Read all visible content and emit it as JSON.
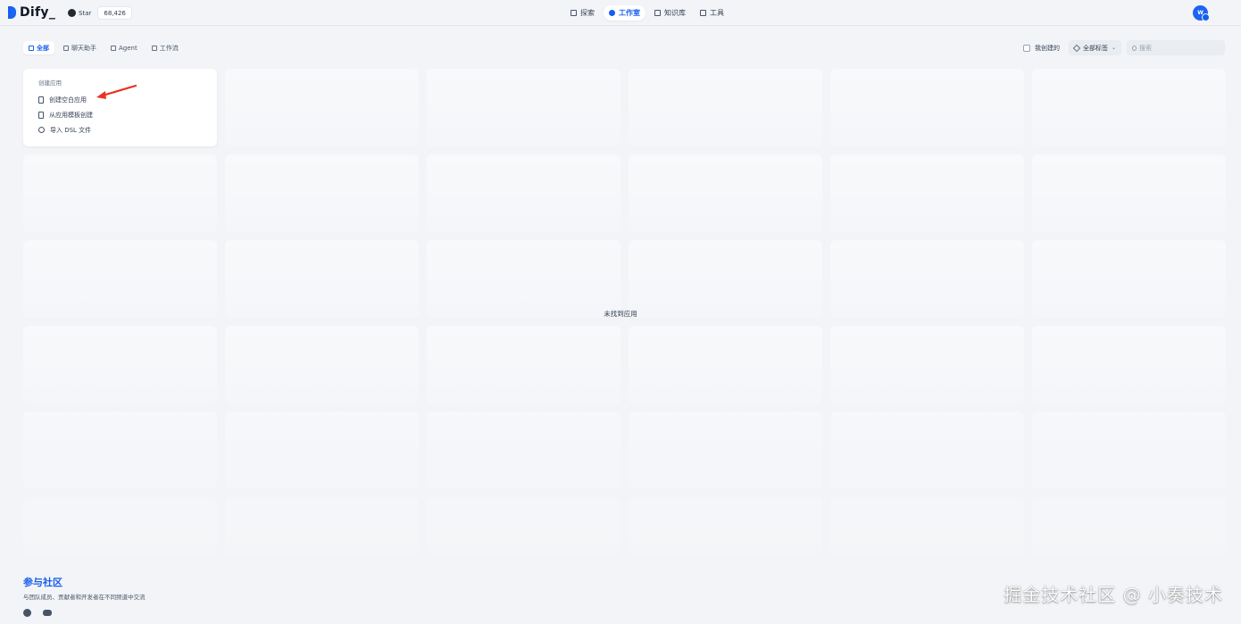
{
  "brand": {
    "logo_text": "Dify_"
  },
  "github": {
    "star_label": "Star",
    "star_count": "68,426"
  },
  "nav": [
    {
      "label": "探索",
      "icon": "compass-icon"
    },
    {
      "label": "工作室",
      "icon": "studio-icon",
      "active": true
    },
    {
      "label": "知识库",
      "icon": "book-icon"
    },
    {
      "label": "工具",
      "icon": "hammer-icon"
    }
  ],
  "user": {
    "avatar_initial": "W"
  },
  "tabs": [
    {
      "label": "全部",
      "icon": "grid-icon",
      "active": true
    },
    {
      "label": "聊天助手",
      "icon": "chat-icon"
    },
    {
      "label": "Agent",
      "icon": "agent-icon"
    },
    {
      "label": "工作流",
      "icon": "workflow-icon"
    }
  ],
  "filters": {
    "mine_label": "我创建的",
    "tags_label": "全部标签",
    "search_placeholder": "搜索"
  },
  "create": {
    "title": "创建应用",
    "items": [
      {
        "label": "创建空白应用",
        "icon": "blank-doc-icon"
      },
      {
        "label": "从应用模板创建",
        "icon": "template-icon"
      },
      {
        "label": "导入 DSL 文件",
        "icon": "import-icon"
      }
    ]
  },
  "empty_message": "未找到应用",
  "community": {
    "title": "参与社区",
    "description": "与团队成员、贡献者和开发者在不同频道中交流"
  },
  "watermark": "掘金技术社区 @ 小奏技术",
  "colors": {
    "accent": "#155eef",
    "arrow": "#e8331f",
    "background": "#f2f4f7"
  }
}
